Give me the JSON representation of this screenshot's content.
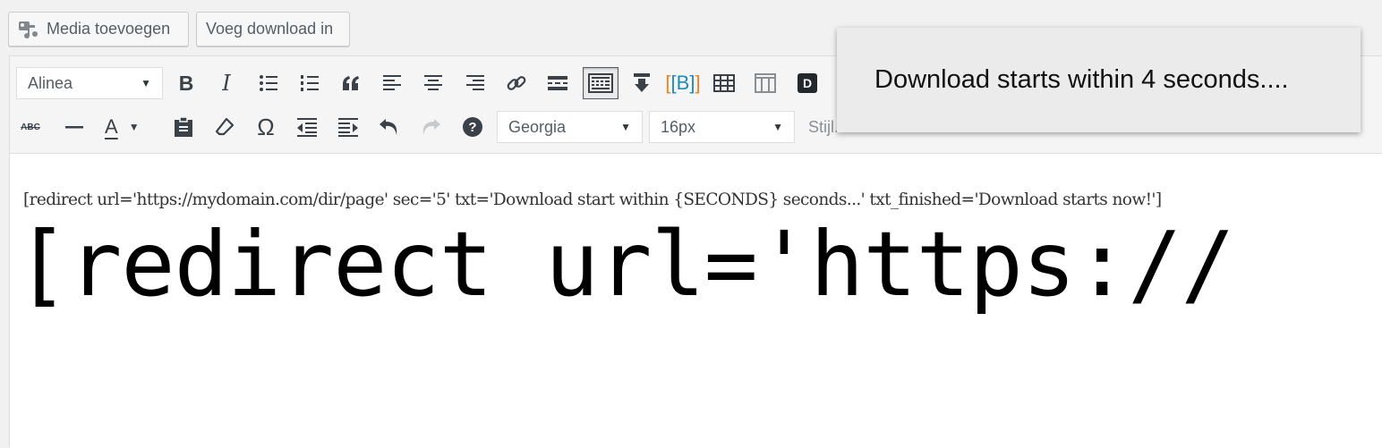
{
  "media_bar": {
    "add_media_label": "Media toevoegen",
    "insert_download_label": "Voeg download in"
  },
  "toolbar": {
    "row1": {
      "format_select": "Alinea",
      "buttons": [
        "bold",
        "italic",
        "bulleted-list",
        "numbered-list",
        "blockquote",
        "align-left",
        "align-center",
        "align-right",
        "insert-link",
        "read-more",
        "toolbar-toggle",
        "download",
        "bracket-shortcode",
        "table",
        "columns",
        "d-plugin"
      ],
      "bold_glyph": "B",
      "italic_glyph": "I",
      "bracket_glyph": "[B]",
      "d_glyph": "D"
    },
    "row2": {
      "buttons": [
        "strikethrough",
        "horizontal-line",
        "text-color",
        "paste-as-text",
        "clear-formatting",
        "special-character",
        "outdent",
        "indent",
        "undo",
        "redo",
        "help"
      ],
      "strike_glyph": "ABC",
      "text_color_glyph": "A",
      "omega_glyph": "Ω",
      "help_glyph": "?",
      "font_select": "Georgia",
      "size_select": "16px",
      "styles_label": "Stijl..."
    },
    "colors": {
      "active_border": "#555d66",
      "bracket_orange": "#f0821e",
      "bracket_blue": "#1e8cbe"
    }
  },
  "content": {
    "shortcode_text": "[redirect url='https://mydomain.com/dir/page' sec='5' txt='Download start within {SECONDS} seconds...' txt_finished='Download starts now!']",
    "big_text": "[redirect url='https://"
  },
  "toast": {
    "message": "Download starts within 4 seconds...."
  }
}
